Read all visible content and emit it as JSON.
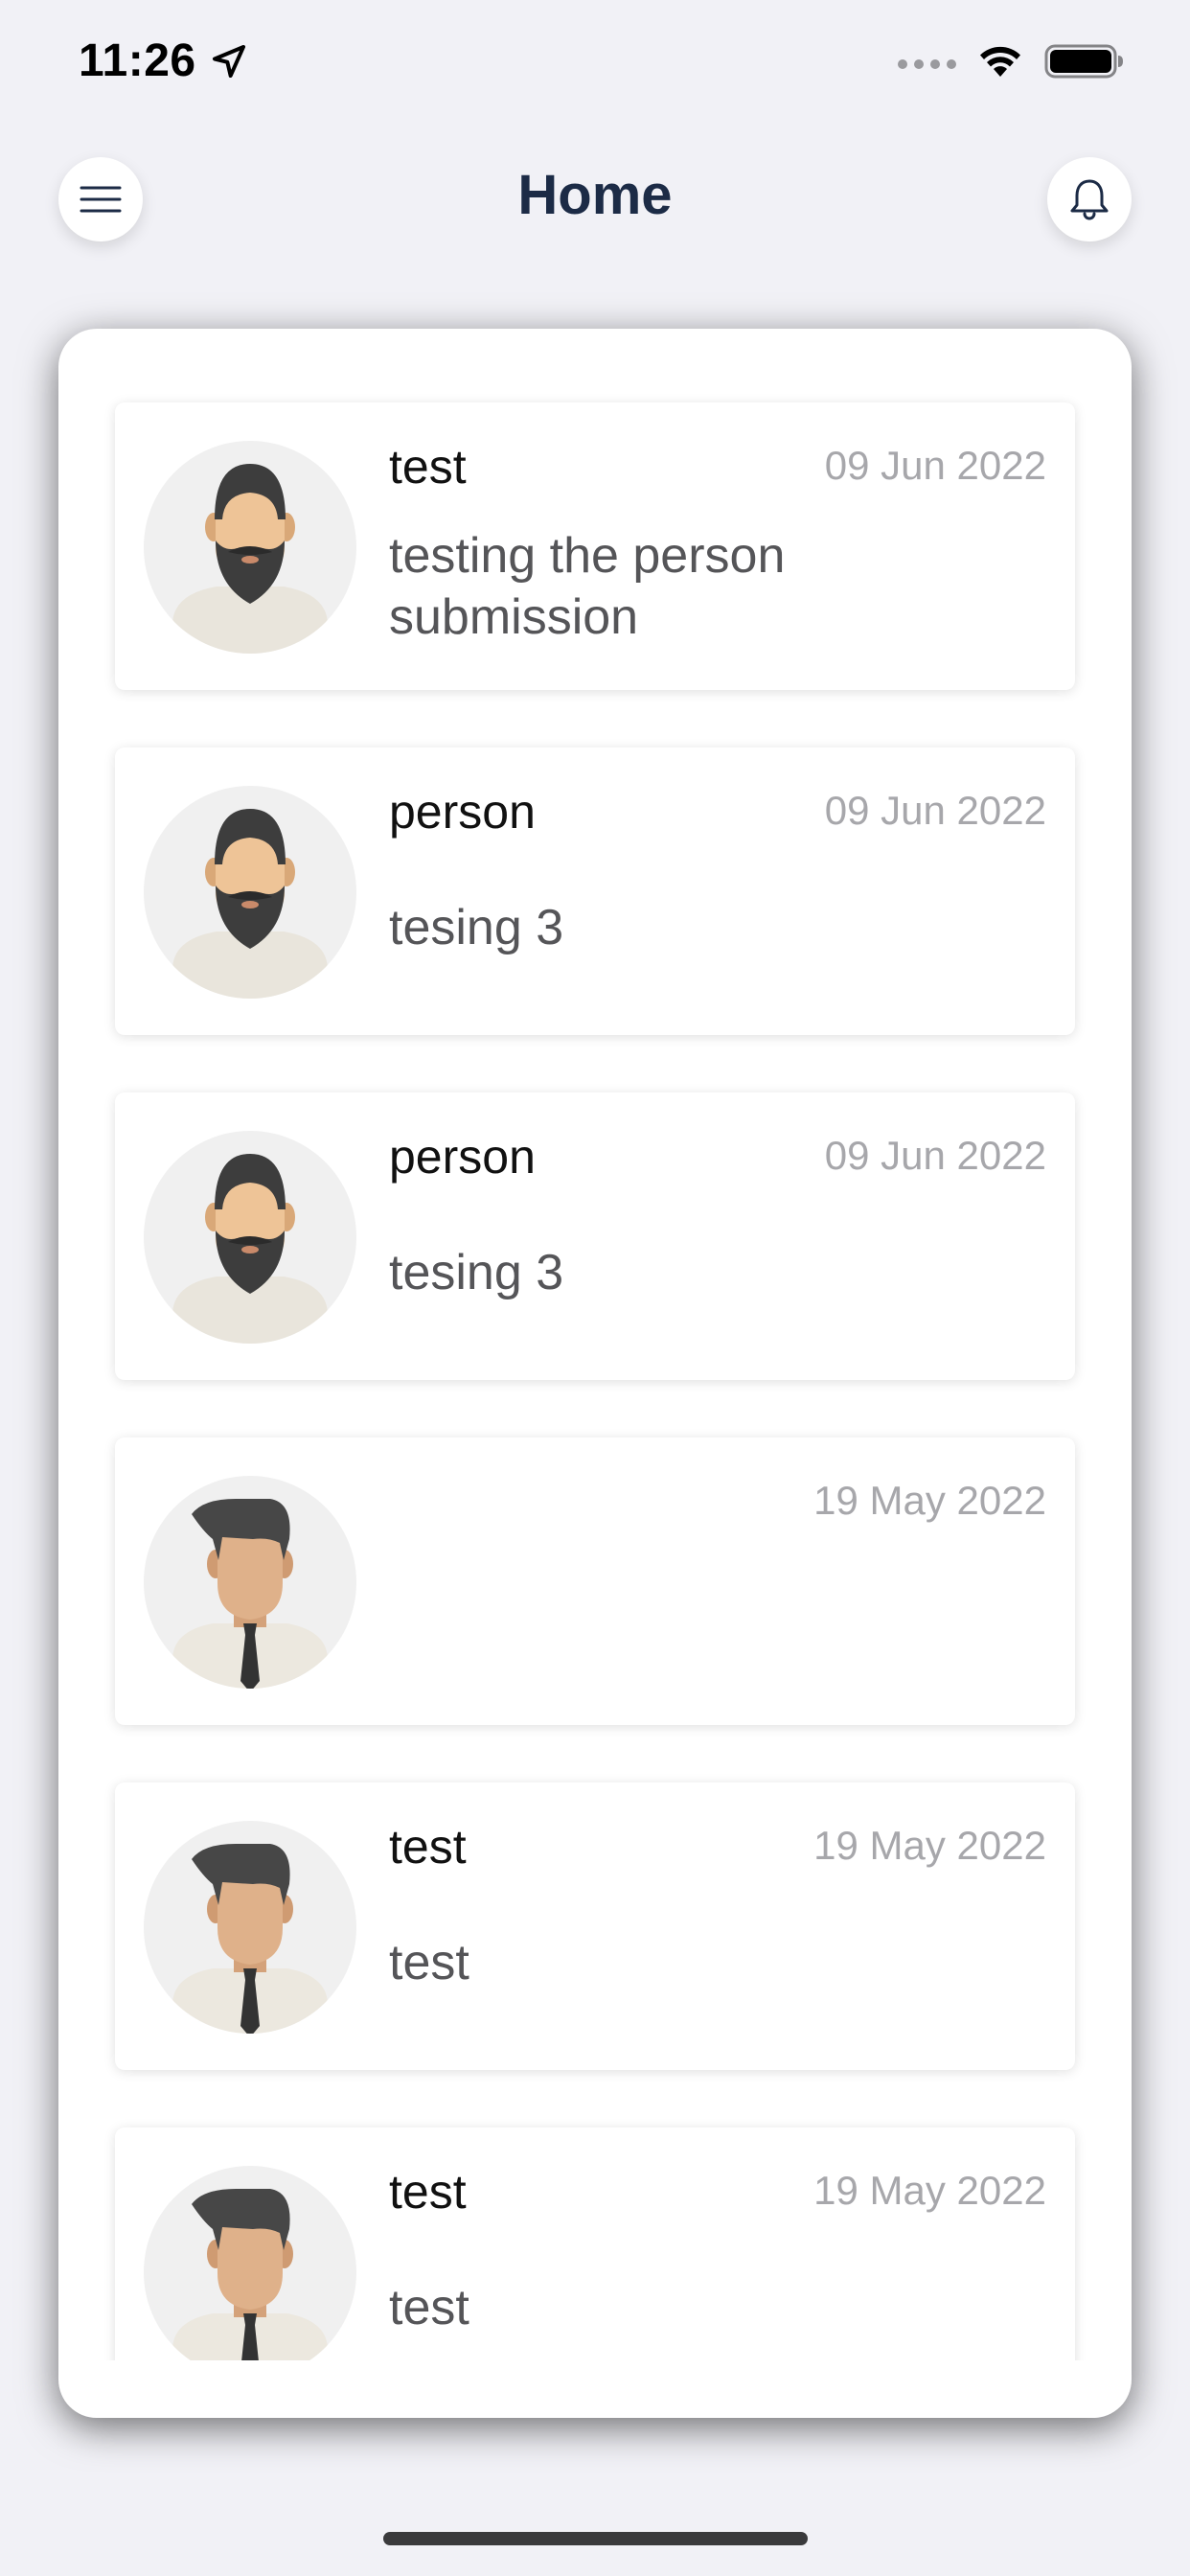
{
  "status_bar": {
    "time": "11:26"
  },
  "header": {
    "title": "Home",
    "menu_icon": "hamburger-menu-icon",
    "notification_icon": "bell-icon"
  },
  "colors": {
    "background": "#f1f1f6",
    "title": "#1c2b46",
    "date": "#a7a7ab",
    "body_text": "#555558"
  },
  "posts": [
    {
      "name": "test",
      "date": "09 Jun 2022",
      "body": "testing the person submission",
      "avatar": "bearded-man-avatar-icon"
    },
    {
      "name": "person",
      "date": "09 Jun 2022",
      "body": "tesing 3",
      "avatar": "bearded-man-avatar-icon"
    },
    {
      "name": "person",
      "date": "09 Jun 2022",
      "body": "tesing 3",
      "avatar": "bearded-man-avatar-icon"
    },
    {
      "name": "",
      "date": "19 May 2022",
      "body": "",
      "avatar": "man-with-tie-avatar-icon"
    },
    {
      "name": "test",
      "date": "19 May 2022",
      "body": "test",
      "avatar": "man-with-tie-avatar-icon"
    },
    {
      "name": "test",
      "date": "19 May 2022",
      "body": "test",
      "avatar": "man-with-tie-avatar-icon"
    }
  ]
}
